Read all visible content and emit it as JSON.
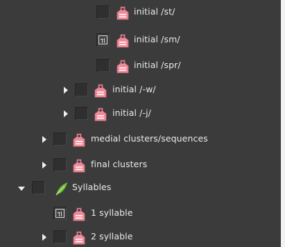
{
  "tree": {
    "items": [
      {
        "label": "initial /st/",
        "level": 4,
        "expandable": false,
        "expanded": false,
        "checkbox": "empty",
        "icon": "tag-icon"
      },
      {
        "label": "initial /sm/",
        "level": 4,
        "expandable": false,
        "expanded": false,
        "checkbox": "image",
        "icon": "tag-icon"
      },
      {
        "label": "initial /spr/",
        "level": 4,
        "expandable": false,
        "expanded": false,
        "checkbox": "empty",
        "icon": "tag-icon"
      },
      {
        "label": "initial /-w/",
        "level": 3,
        "expandable": true,
        "expanded": false,
        "checkbox": "empty",
        "icon": "tag-icon"
      },
      {
        "label": "initial /-j/",
        "level": 3,
        "expandable": true,
        "expanded": false,
        "checkbox": "empty",
        "icon": "tag-icon"
      },
      {
        "label": "medial clusters/sequences",
        "level": 2,
        "expandable": true,
        "expanded": false,
        "checkbox": "empty",
        "icon": "tag-icon"
      },
      {
        "label": "final clusters",
        "level": 2,
        "expandable": true,
        "expanded": false,
        "checkbox": "empty",
        "icon": "tag-icon"
      },
      {
        "label": "Syllables",
        "level": 1,
        "expandable": true,
        "expanded": true,
        "checkbox": "empty",
        "icon": "leaf-icon"
      },
      {
        "label": "1 syllable",
        "level": 2,
        "expandable": false,
        "expanded": false,
        "checkbox": "image",
        "icon": "tag-icon"
      },
      {
        "label": "2 syllable",
        "level": 2,
        "expandable": true,
        "expanded": false,
        "checkbox": "empty",
        "icon": "tag-icon"
      }
    ]
  },
  "colors": {
    "background": "#3b3b3b",
    "text": "#eaeaea",
    "tag_pink": "#f08a9a",
    "leaf_green": "#6fbf3a"
  }
}
